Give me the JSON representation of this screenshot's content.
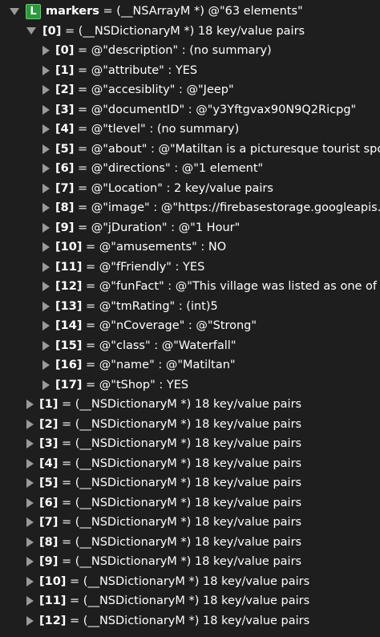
{
  "root": {
    "badge": "L",
    "name": "markers",
    "desc": " = (__NSArrayM *) @\"63 elements\""
  },
  "open_item": {
    "index": "[0]",
    "desc": " = (__NSDictionaryM *) 18 key/value pairs"
  },
  "children": [
    {
      "index": "[0]",
      "desc": " = @\"description\" : (no summary)"
    },
    {
      "index": "[1]",
      "desc": " = @\"attribute\" : YES"
    },
    {
      "index": "[2]",
      "desc": " = @\"accesiblity\" : @\"Jeep\""
    },
    {
      "index": "[3]",
      "desc": " = @\"documentID\" : @\"y3Yftgvax90N9Q2Ricpg\""
    },
    {
      "index": "[4]",
      "desc": " = @\"tlevel\" : (no summary)"
    },
    {
      "index": "[5]",
      "desc": " = @\"about\" : @\"Matiltan is a picturesque tourist spot, l"
    },
    {
      "index": "[6]",
      "desc": " = @\"directions\" : @\"1 element\""
    },
    {
      "index": "[7]",
      "desc": " = @\"Location\" : 2 key/value pairs"
    },
    {
      "index": "[8]",
      "desc": " = @\"image\" : @\"https://firebasestorage.googleapis.com"
    },
    {
      "index": "[9]",
      "desc": " = @\"jDuration\" : @\"1 Hour\""
    },
    {
      "index": "[10]",
      "desc": " = @\"amusements\" : NO"
    },
    {
      "index": "[11]",
      "desc": " = @\"fFriendly\" : YES"
    },
    {
      "index": "[12]",
      "desc": " = @\"funFact\" : @\"This village was listed as one of the"
    },
    {
      "index": "[13]",
      "desc": " = @\"tmRating\" : (int)5"
    },
    {
      "index": "[14]",
      "desc": " = @\"nCoverage\" : @\"Strong\""
    },
    {
      "index": "[15]",
      "desc": " = @\"class\" : @\"Waterfall\""
    },
    {
      "index": "[16]",
      "desc": " = @\"name\" : @\"Matiltan\""
    },
    {
      "index": "[17]",
      "desc": " = @\"tShop\" : YES"
    }
  ],
  "siblings": [
    {
      "index": "[1]",
      "desc": " = (__NSDictionaryM *) 18 key/value pairs"
    },
    {
      "index": "[2]",
      "desc": " = (__NSDictionaryM *) 18 key/value pairs"
    },
    {
      "index": "[3]",
      "desc": " = (__NSDictionaryM *) 18 key/value pairs"
    },
    {
      "index": "[4]",
      "desc": " = (__NSDictionaryM *) 18 key/value pairs"
    },
    {
      "index": "[5]",
      "desc": " = (__NSDictionaryM *) 18 key/value pairs"
    },
    {
      "index": "[6]",
      "desc": " = (__NSDictionaryM *) 18 key/value pairs"
    },
    {
      "index": "[7]",
      "desc": " = (__NSDictionaryM *) 18 key/value pairs"
    },
    {
      "index": "[8]",
      "desc": " = (__NSDictionaryM *) 18 key/value pairs"
    },
    {
      "index": "[9]",
      "desc": " = (__NSDictionaryM *) 18 key/value pairs"
    },
    {
      "index": "[10]",
      "desc": " = (__NSDictionaryM *) 18 key/value pairs"
    },
    {
      "index": "[11]",
      "desc": " = (__NSDictionaryM *) 18 key/value pairs"
    },
    {
      "index": "[12]",
      "desc": " = (__NSDictionaryM *) 18 key/value pairs"
    }
  ],
  "colors": {
    "background": "#1e1e1e",
    "text": "#ffffff",
    "disclosure": "#9a9a9a",
    "badge": "#2b9a3a"
  }
}
